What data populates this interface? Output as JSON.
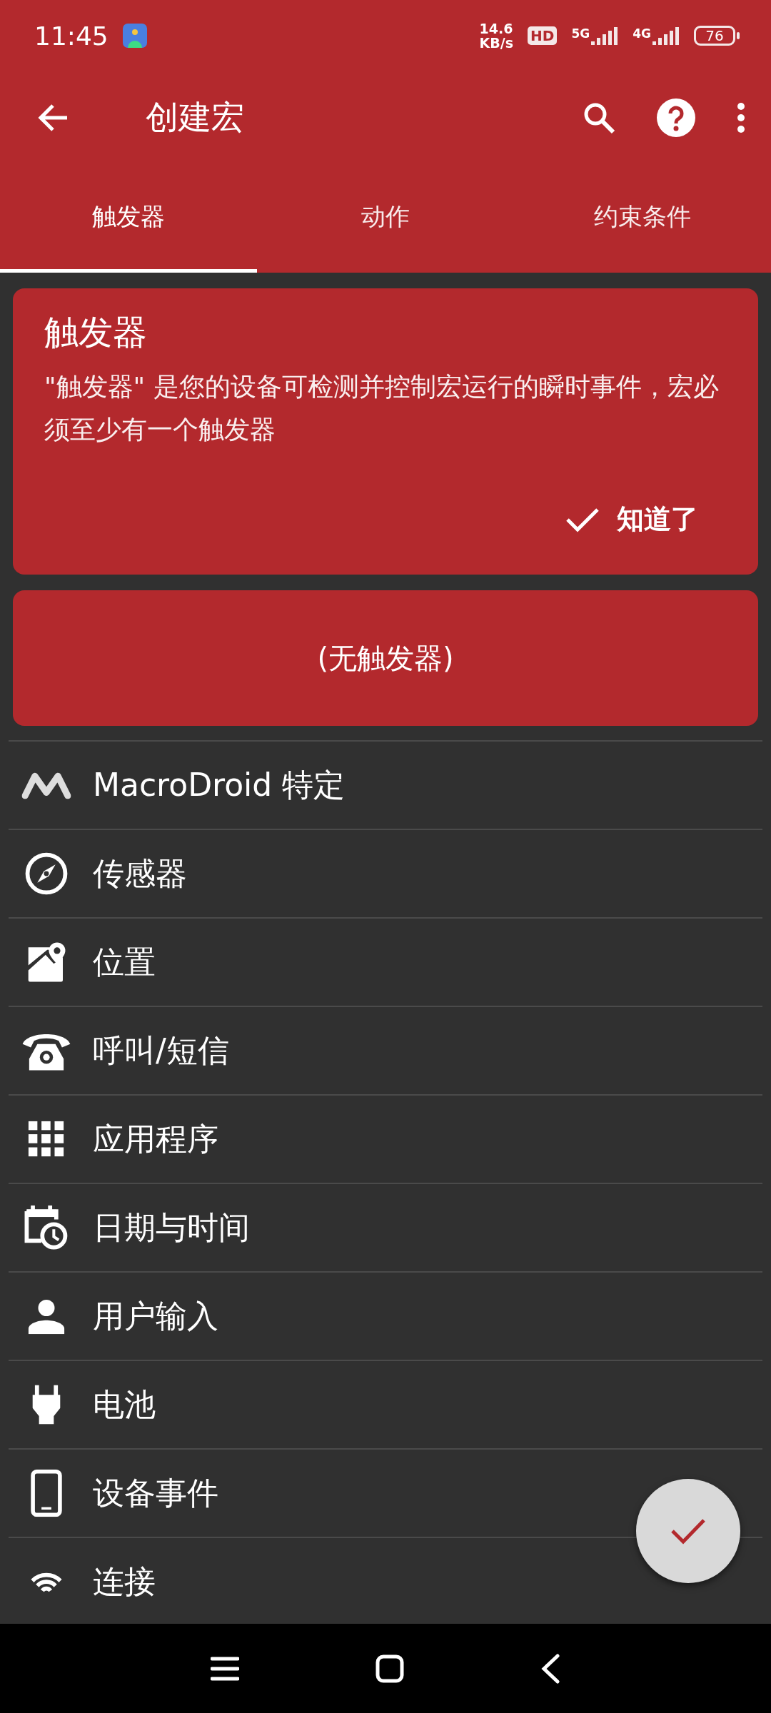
{
  "status_bar": {
    "time": "11:45",
    "speed_value": "14.6",
    "speed_unit": "KB/s",
    "hd": "HD",
    "network_1": "5G",
    "network_2": "4G",
    "battery": "76"
  },
  "app_bar": {
    "title": "创建宏"
  },
  "tabs": [
    {
      "label": "触发器",
      "selected": true
    },
    {
      "label": "动作",
      "selected": false
    },
    {
      "label": "约束条件",
      "selected": false
    }
  ],
  "info_card": {
    "title": "触发器",
    "body": "\"触发器\" 是您的设备可检测并控制宏运行的瞬时事件，宏必须至少有一个触发器",
    "button": "知道了"
  },
  "empty_card": {
    "text": "(无触发器)"
  },
  "categories": [
    {
      "label": "MacroDroid 特定"
    },
    {
      "label": "传感器"
    },
    {
      "label": "位置"
    },
    {
      "label": "呼叫/短信"
    },
    {
      "label": "应用程序"
    },
    {
      "label": "日期与时间"
    },
    {
      "label": "用户输入"
    },
    {
      "label": "电池"
    },
    {
      "label": "设备事件"
    },
    {
      "label": "连接"
    }
  ]
}
